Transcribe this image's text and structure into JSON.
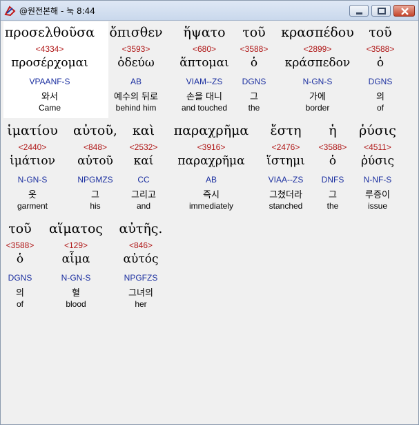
{
  "window": {
    "title": "@원전본해 - 눅 8:44"
  },
  "words": [
    {
      "greek": "προσελθοῦσα",
      "strong": "<4334>",
      "lemma": "προσέρχομαι",
      "parse": "VPAANF-S",
      "korean": "와서",
      "english": "Came"
    },
    {
      "greek": "ὄπισθεν",
      "strong": "<3593>",
      "lemma": "ὁδεύω",
      "parse": "AB",
      "korean": "예수의 뒤로",
      "english": "behind him"
    },
    {
      "greek": "ἥψατο",
      "strong": "<680>",
      "lemma": "ἅπτομαι",
      "parse": "VIAM--ZS",
      "korean": "손을 대니",
      "english": "and touched"
    },
    {
      "greek": "τοῦ",
      "strong": "<3588>",
      "lemma": "ὁ",
      "parse": "DGNS",
      "korean": "그",
      "english": "the"
    },
    {
      "greek": "κρασπέδου",
      "strong": "<2899>",
      "lemma": "κράσπεδον",
      "parse": "N-GN-S",
      "korean": "가에",
      "english": "border"
    },
    {
      "greek": "τοῦ",
      "strong": "<3588>",
      "lemma": "ὁ",
      "parse": "DGNS",
      "korean": "의",
      "english": "of"
    },
    {
      "greek": "ἱματίου",
      "strong": "<2440>",
      "lemma": "ἱμάτιον",
      "parse": "N-GN-S",
      "korean": "옷",
      "english": "garment"
    },
    {
      "greek": "αὐτοῦ,",
      "strong": "<848>",
      "lemma": "αὐτοῦ",
      "parse": "NPGMZS",
      "korean": "그",
      "english": "his"
    },
    {
      "greek": "καὶ",
      "strong": "<2532>",
      "lemma": "καί",
      "parse": "CC",
      "korean": "그리고",
      "english": "and"
    },
    {
      "greek": "παραχρῆμα",
      "strong": "<3916>",
      "lemma": "παραχρῆμα",
      "parse": "AB",
      "korean": "즉시",
      "english": "immediately"
    },
    {
      "greek": "ἔστη",
      "strong": "<2476>",
      "lemma": "ἵστημι",
      "parse": "VIAA--ZS",
      "korean": "그쳤더라",
      "english": "stanched"
    },
    {
      "greek": "ἡ",
      "strong": "<3588>",
      "lemma": "ὁ",
      "parse": "DNFS",
      "korean": "그",
      "english": "the"
    },
    {
      "greek": "ῥύσις",
      "strong": "<4511>",
      "lemma": "ῥύσις",
      "parse": "N-NF-S",
      "korean": "루증이",
      "english": "issue"
    },
    {
      "greek": "τοῦ",
      "strong": "<3588>",
      "lemma": "ὁ",
      "parse": "DGNS",
      "korean": "의",
      "english": "of"
    },
    {
      "greek": "αἵματος",
      "strong": "<129>",
      "lemma": "αἷμα",
      "parse": "N-GN-S",
      "korean": "혈",
      "english": "blood"
    },
    {
      "greek": "αὐτῆς.",
      "strong": "<846>",
      "lemma": "αὐτός",
      "parse": "NPGFZS",
      "korean": "그녀의",
      "english": "her"
    }
  ]
}
